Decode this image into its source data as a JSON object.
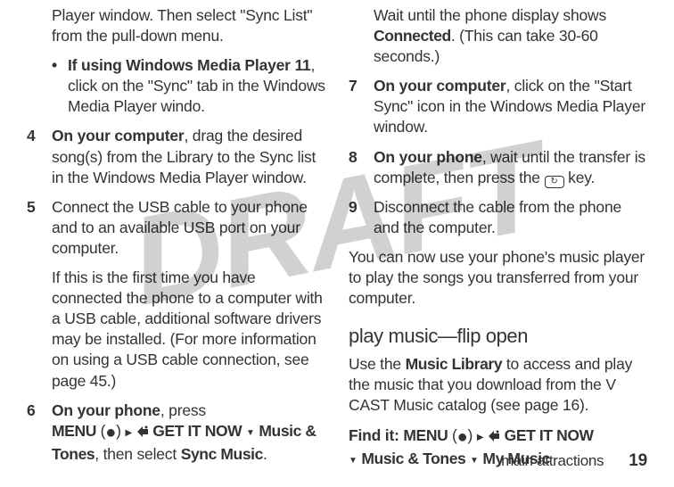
{
  "watermark": "DRAFT",
  "left": {
    "cont1": "Player window. Then select \"Sync List\" from the pull-down menu.",
    "bullet1_b": "If using Windows Media Player 11",
    "bullet1_rest": ", click on the \"Sync\" tab in the Windows Media Player windo.",
    "s4_num": "4",
    "s4_b": "On your computer",
    "s4_rest": ", drag the desired song(s) from the Library to the Sync list in the Windows Media Player window.",
    "s5_num": "5",
    "s5_p1": "Connect the USB cable to your phone and to an available USB port on your computer.",
    "s5_p2": "If this is the first time you have connected the phone to a computer with a USB cable, additional software drivers may be installed. (For more information on using a USB cable connection, see page 45.)",
    "s6_num": "6",
    "s6_b": "On your phone",
    "s6_rest": ", press",
    "s6_menu": "MENU",
    "s6_get": "GET IT NOW",
    "s6_music": "Music & Tones",
    "s6_then": ", then select ",
    "s6_sync": "Sync Music",
    "s6_end": "."
  },
  "right": {
    "cont1_a": "Wait until the phone display shows ",
    "cont1_b": "Connected",
    "cont1_c": ". (This can take 30-60 seconds.)",
    "s7_num": "7",
    "s7_b": "On your computer",
    "s7_rest": ", click on the \"Start Sync\" icon in the Windows Media Player window.",
    "s8_num": "8",
    "s8_b": "On your phone",
    "s8_rest1": ", wait until the transfer is complete, then press the ",
    "s8_rest2": " key.",
    "s9_num": "9",
    "s9_text": "Disconnect the cable from the phone and the computer.",
    "para": "You can now use your phone's music player to play the songs you transferred from your computer.",
    "heading": "play music—flip open",
    "use1": "Use the ",
    "use_b": "Music Library",
    "use2": " to access and play the music that you download from the V CAST Music catalog (see page 16).",
    "find": "Find it:  ",
    "f_menu": "MENU",
    "f_get": "GET IT NOW",
    "f_music": "Music & Tones",
    "f_my": "My Music"
  },
  "footer": {
    "section": "main attractions",
    "page": "19"
  }
}
